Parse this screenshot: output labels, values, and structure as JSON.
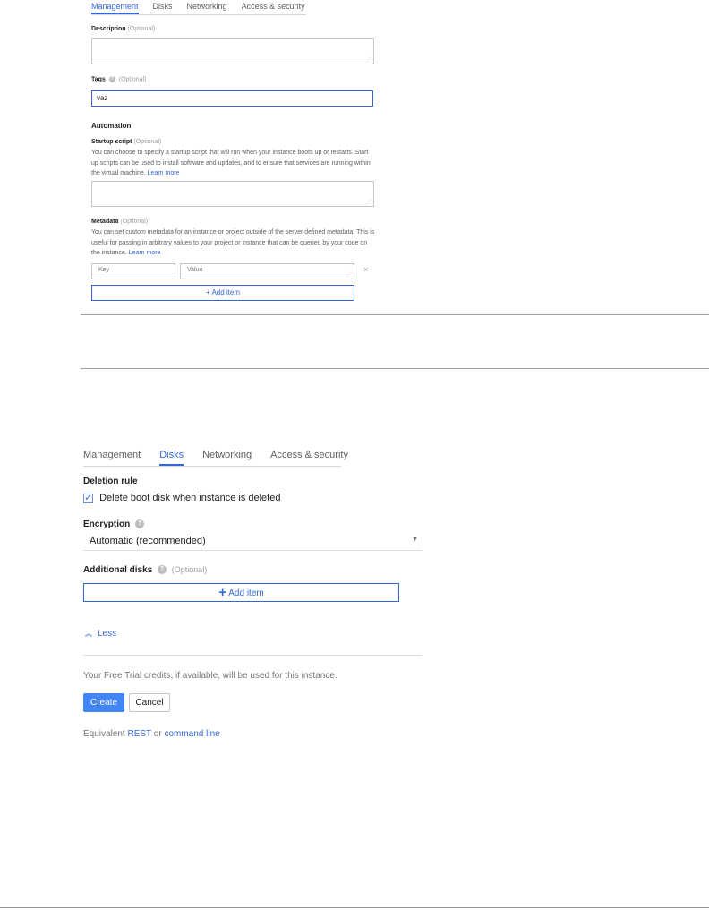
{
  "top": {
    "tabs": [
      "Management",
      "Disks",
      "Networking",
      "Access & security"
    ],
    "description_label": "Description",
    "description_optional": "(Optional)",
    "tags_label": "Tags",
    "tags_optional": "(Optional)",
    "tags_value": "vaz",
    "automation_heading": "Automation",
    "startup_label": "Startup script",
    "startup_optional": "(Optional)",
    "startup_desc": "You can choose to specify a startup script that will run when your instance boots up or restarts. Start up scripts can be used to install software and updates, and to ensure that services are running within the virtual machine.",
    "learn_more": "Learn more",
    "metadata_label": "Metadata",
    "metadata_optional": "(Optional)",
    "metadata_desc": "You can set custom metadata for an instance or project outside of the server defined metadata. This is useful for passing in arbitrary values to your project or instance that can be queried by your code on the instance.",
    "key_placeholder": "Key",
    "value_placeholder": "Value",
    "remove_icon_glyph": "×",
    "add_item": "+ Add item"
  },
  "bottom": {
    "tabs": [
      "Management",
      "Disks",
      "Networking",
      "Access & security"
    ],
    "active_tab": "Disks",
    "deletion_rule_label": "Deletion rule",
    "delete_boot_disk_label": "Delete boot disk when instance is deleted",
    "delete_boot_disk_checked": true,
    "encryption_label": "Encryption",
    "encryption_value": "Automatic (recommended)",
    "additional_disks_label": "Additional disks",
    "additional_disks_optional": "(Optional)",
    "add_item_plus": "+",
    "add_item": "Add item",
    "less_label": "Less",
    "free_trial_text": "Your Free Trial credits, if available, will be used for this instance.",
    "create_label": "Create",
    "cancel_label": "Cancel",
    "equivalent_text": "Equivalent",
    "rest_link": "REST",
    "or_text": "or",
    "command_line_link": "command line"
  },
  "colors": {
    "accent": "#3367d6",
    "primary_button": "#4285f4",
    "muted_text": "#9e9e9e",
    "border": "#c6c6c6"
  }
}
